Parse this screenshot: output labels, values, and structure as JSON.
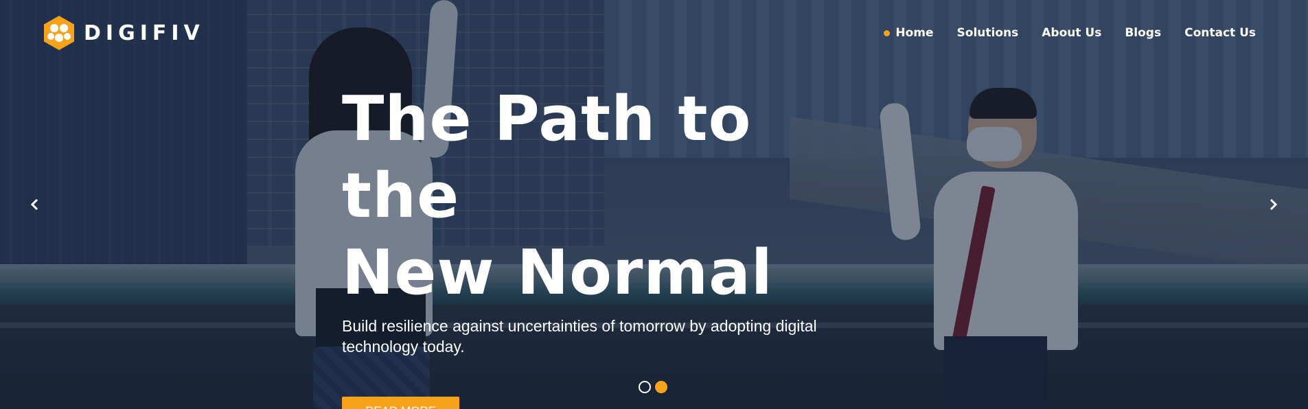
{
  "brand": {
    "name": "DIGIFIV",
    "logo_icon": "hexagon-cluster-icon"
  },
  "nav": {
    "items": [
      {
        "label": "Home",
        "active": true
      },
      {
        "label": "Solutions",
        "active": false
      },
      {
        "label": "About Us",
        "active": false
      },
      {
        "label": "Blogs",
        "active": false
      },
      {
        "label": "Contact Us",
        "active": false
      }
    ]
  },
  "hero": {
    "headline_line1": "The Path to the",
    "headline_line2": "New Normal",
    "subtitle": "Build resilience against uncertainties of tomorrow by adopting digital technology today.",
    "cta_label": "READ MORE"
  },
  "slider": {
    "prev_icon": "chevron-left-icon",
    "next_icon": "chevron-right-icon",
    "slide_count": 2,
    "active_slide": 2
  },
  "colors": {
    "accent": "#f7a21b",
    "text": "#ffffff",
    "overlay": "#16223a"
  }
}
